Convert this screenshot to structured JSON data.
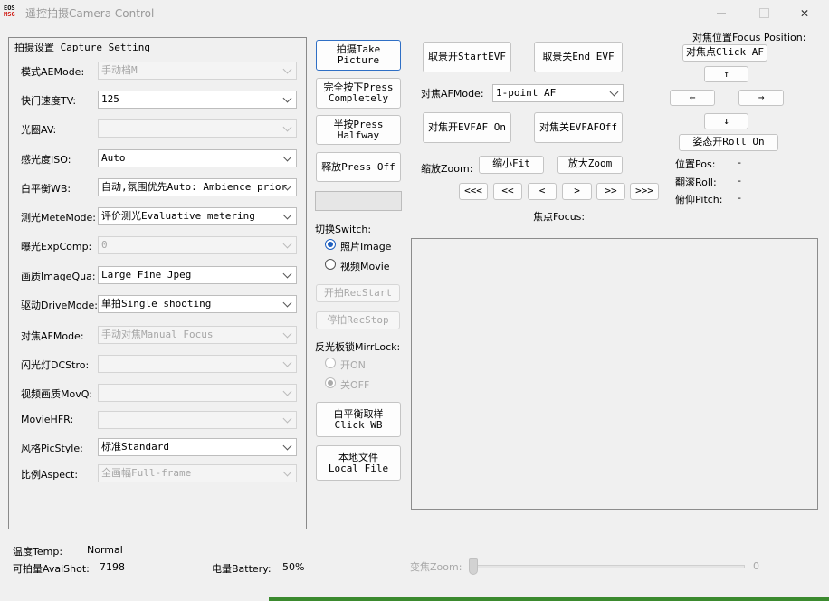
{
  "window": {
    "title": "遥控拍摄Camera Control",
    "icon_top": "EOS",
    "icon_bottom": "MSG"
  },
  "capture": {
    "group_title": "拍摄设置 Capture Setting",
    "rows": [
      {
        "label": "模式AEMode:",
        "value": "手动档M",
        "enabled": false
      },
      {
        "label": "快门速度TV:",
        "value": "125",
        "enabled": true
      },
      {
        "label": "光圈AV:",
        "value": "",
        "enabled": false
      },
      {
        "label": "感光度ISO:",
        "value": "Auto",
        "enabled": true
      },
      {
        "label": "白平衡WB:",
        "value": "自动,氛围优先Auto: Ambience prior",
        "enabled": true
      },
      {
        "label": "测光MeteMode:",
        "value": "评价测光Evaluative metering",
        "enabled": true
      },
      {
        "label": "曝光ExpComp:",
        "value": "0",
        "enabled": false
      },
      {
        "label": "画质ImageQua:",
        "value": "Large Fine Jpeg",
        "enabled": true
      },
      {
        "label": "驱动DriveMode:",
        "value": "单拍Single shooting",
        "enabled": true
      },
      {
        "label": "对焦AFMode:",
        "value": "手动对焦Manual Focus",
        "enabled": false
      },
      {
        "label": "闪光灯DCStro:",
        "value": "",
        "enabled": false
      },
      {
        "label": "视频画质MovQ:",
        "value": "",
        "enabled": false
      },
      {
        "label": "MovieHFR:",
        "value": "",
        "enabled": false
      },
      {
        "label": "风格PicStyle:",
        "value": "标准Standard",
        "enabled": true
      },
      {
        "label": "比例Aspect:",
        "value": "全画幅Full-frame",
        "enabled": false
      }
    ]
  },
  "actions": {
    "take_picture": [
      "拍摄Take",
      "Picture"
    ],
    "press_completely": [
      "完全按下Press",
      "Completely"
    ],
    "press_halfway": [
      "半按Press",
      "Halfway"
    ],
    "press_off": "释放Press Off",
    "switch_label": "切换Switch:",
    "radio_image": "照片Image",
    "radio_movie": "视频Movie",
    "rec_start": "开拍RecStart",
    "rec_stop": "停拍RecStop",
    "mirror_lock_label": "反光板锁MirrLock:",
    "radio_on": "开ON",
    "radio_off": "关OFF",
    "click_wb": [
      "白平衡取样",
      "Click WB"
    ],
    "local_file": [
      "本地文件",
      "Local File"
    ]
  },
  "evf": {
    "start_evf": "取景开StartEVF",
    "end_evf": "取景关End EVF",
    "af_mode_label": "对焦AFMode:",
    "af_mode_value": "1-point AF",
    "evf_af_on": "对焦开EVFAF On",
    "evf_af_off": "对焦关EVFAFOff",
    "zoom_label": "缩放Zoom:",
    "zoom_fit": "缩小Fit",
    "zoom_in": "放大Zoom",
    "nav": [
      "<<<",
      "<<",
      "<",
      ">",
      ">>",
      ">>>"
    ],
    "focus_label": "焦点Focus:"
  },
  "focus_position": {
    "title": "对焦位置Focus Position:",
    "click_af": "对焦点Click AF",
    "up": "↑",
    "left": "←",
    "right": "→",
    "down": "↓",
    "roll_on": "姿态开Roll On",
    "pos_label": "位置Pos:",
    "pos_value": "-",
    "roll_label": "翻滚Roll:",
    "roll_value": "-",
    "pitch_label": "俯仰Pitch:",
    "pitch_value": "-"
  },
  "status": {
    "temp_label": "温度Temp:",
    "temp_value": "Normal",
    "shots_label": "可拍量AvaiShot:",
    "shots_value": "7198",
    "battery_label": "电量Battery:",
    "battery_value": "50%",
    "zoom_label": "变焦Zoom:",
    "zoom_value": "0"
  }
}
